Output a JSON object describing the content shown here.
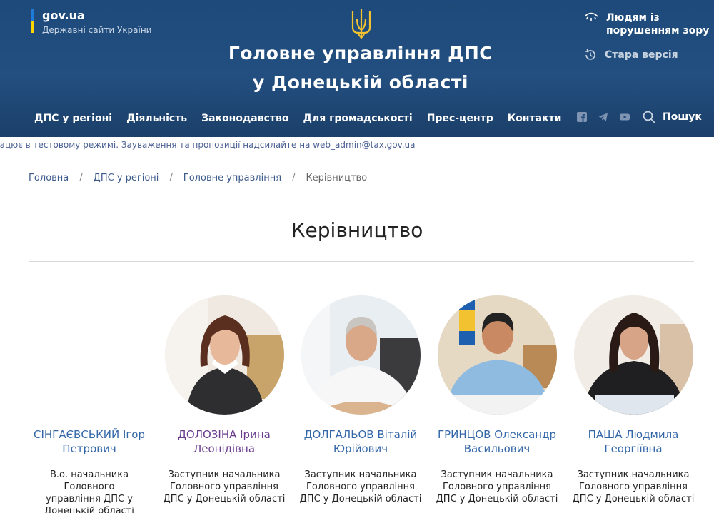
{
  "header": {
    "gov_name": "gov.ua",
    "gov_sub": "Державні сайти України",
    "title_line1": "Головне управління ДПС",
    "title_line2": "у Донецькій області",
    "a11y_label_line1": "Людям із",
    "a11y_label_line2": "порушенням зору",
    "old_version": "Стара версія",
    "search_label": "Пошук"
  },
  "nav": {
    "items": [
      {
        "label": "ДПС у регіоні"
      },
      {
        "label": "Діяльність"
      },
      {
        "label": "Законодавство"
      },
      {
        "label": "Для громадськості"
      },
      {
        "label": "Прес-центр"
      },
      {
        "label": "Контакти"
      }
    ]
  },
  "notice": "рацює в тестовому режимі. Зауваження та пропозиції надсилайте на web_admin@tax.gov.ua",
  "breadcrumb": {
    "items": [
      "Головна",
      "ДПС у регіоні",
      "Головне управління"
    ],
    "current": "Керівництво",
    "separator": "/"
  },
  "page_title": "Керівництво",
  "people": [
    {
      "name_line1": "СІНГАЄВСЬКИЙ Ігор",
      "name_line2": "Петрович",
      "role_line1": "В.о. начальника Головного",
      "role_line2": "управління ДПС у",
      "role_line3": "Донецькій області"
    },
    {
      "name_line1": "ДОЛОЗІНА Ірина",
      "name_line2": "Леонідівна",
      "role_line1": "Заступник начальника",
      "role_line2": "Головного управління",
      "role_line3": "ДПС у Донецькій області"
    },
    {
      "name_line1": "ДОЛГАЛЬОВ Віталій",
      "name_line2": "Юрійович",
      "role_line1": "Заступник начальника",
      "role_line2": "Головного управління",
      "role_line3": "ДПС у Донецькій області"
    },
    {
      "name_line1": "ГРИНЦОВ Олександр",
      "name_line2": "Васильович",
      "role_line1": "Заступник начальника",
      "role_line2": "Головного управління",
      "role_line3": "ДПС у Донецькій області"
    },
    {
      "name_line1": "ПАША Людмила",
      "name_line2": "Георгіївна",
      "role_line1": "Заступник начальника",
      "role_line2": "Головного управління",
      "role_line3": "ДПС у Донецькій області"
    }
  ],
  "colors": {
    "header_bg": "#1d4a7a",
    "link_blue": "#3467a8",
    "link_visited": "#6a3c8e",
    "flag_blue": "#1f7ad8",
    "flag_yellow": "#ffd500",
    "trident_gold": "#f2c230"
  },
  "icons": {
    "a11y": "eye-icon",
    "old_version": "history-icon",
    "facebook": "facebook-icon",
    "telegram": "telegram-icon",
    "youtube": "youtube-icon",
    "search": "search-icon",
    "emblem": "trident-icon"
  }
}
